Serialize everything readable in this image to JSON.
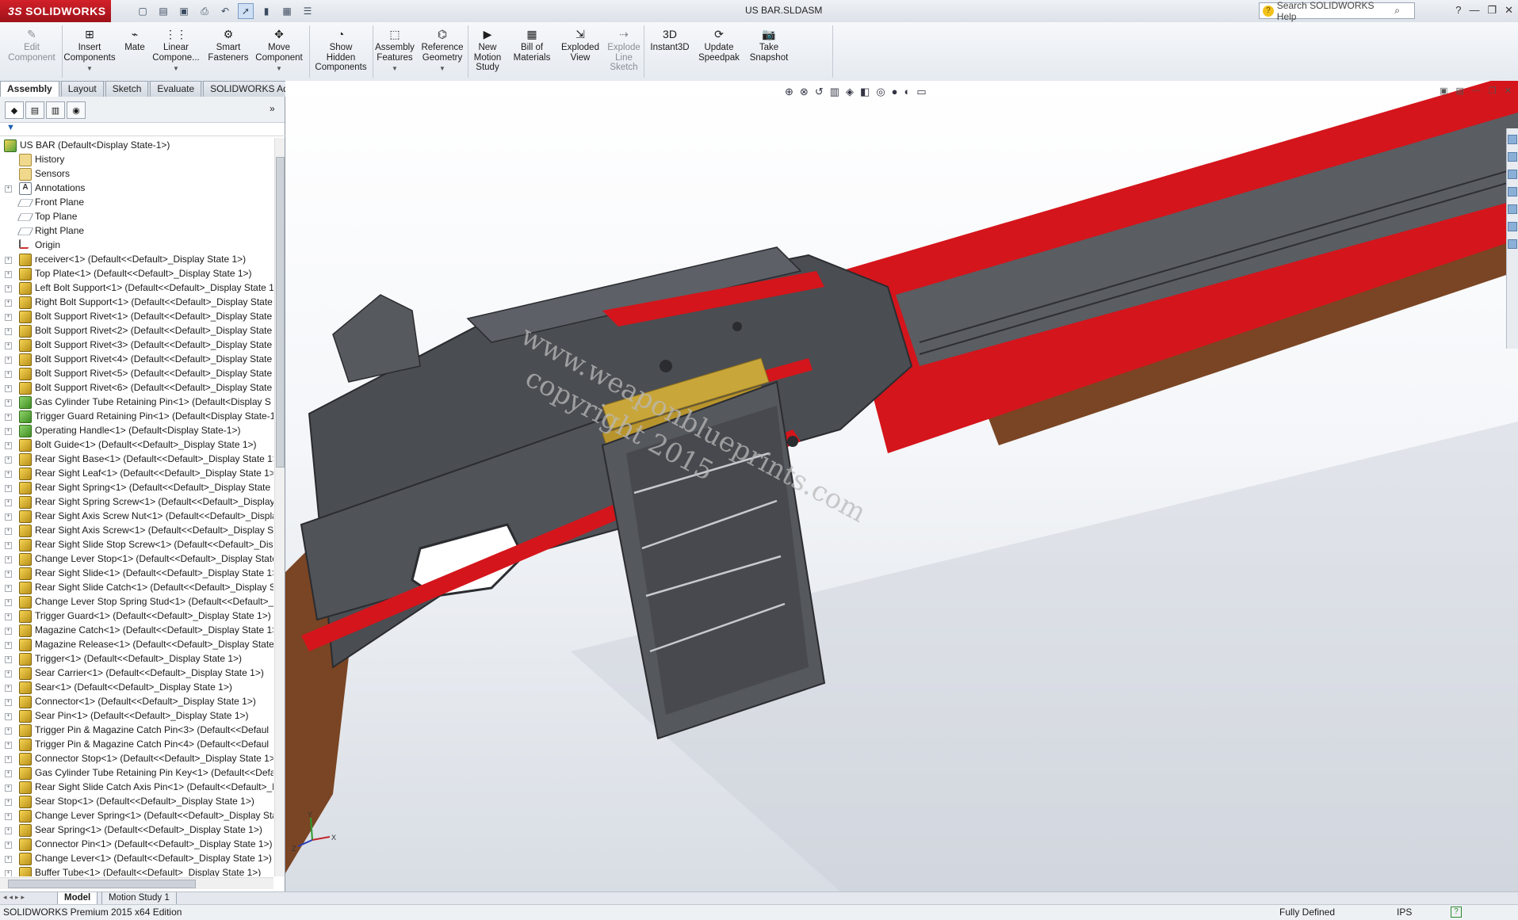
{
  "app": {
    "brand": "SOLIDWORKS",
    "brand_prefix": "3S",
    "document_title": "US BAR.SLDASM"
  },
  "help_search": {
    "placeholder": "Search SOLIDWORKS Help"
  },
  "commands": [
    {
      "label": "Edit\nComponent",
      "icon": "edit-component-icon",
      "disabled": true
    },
    {
      "label": "Insert\nComponents",
      "icon": "insert-components-icon",
      "dropdown": true
    },
    {
      "label": "Mate",
      "icon": "mate-icon"
    },
    {
      "label": "Linear\nCompone...",
      "icon": "linear-pattern-icon",
      "dropdown": true
    },
    {
      "label": "Smart\nFasteners",
      "icon": "smart-fasteners-icon"
    },
    {
      "label": "Move\nComponent",
      "icon": "move-component-icon",
      "dropdown": true
    },
    {
      "label": "Show\nHidden\nComponents",
      "icon": "show-hidden-icon"
    },
    {
      "label": "Assembly\nFeatures",
      "icon": "assembly-features-icon",
      "dropdown": true
    },
    {
      "label": "Reference\nGeometry",
      "icon": "reference-geometry-icon",
      "dropdown": true
    },
    {
      "label": "New\nMotion\nStudy",
      "icon": "motion-study-icon"
    },
    {
      "label": "Bill of\nMaterials",
      "icon": "bom-icon"
    },
    {
      "label": "Exploded\nView",
      "icon": "exploded-view-icon"
    },
    {
      "label": "Explode\nLine\nSketch",
      "icon": "explode-line-sketch-icon",
      "disabled": true
    },
    {
      "label": "Instant3D",
      "icon": "instant3d-icon"
    },
    {
      "label": "Update\nSpeedpak",
      "icon": "speedpak-icon"
    },
    {
      "label": "Take\nSnapshot",
      "icon": "snapshot-icon"
    }
  ],
  "tabs": [
    "Assembly",
    "Layout",
    "Sketch",
    "Evaluate",
    "SOLIDWORKS Add-Ins"
  ],
  "active_tab": "Assembly",
  "tree": {
    "root": "US BAR  (Default<Display State-1>)",
    "items": [
      {
        "label": "History",
        "icon": "folder"
      },
      {
        "label": "Sensors",
        "icon": "folder"
      },
      {
        "label": "Annotations",
        "icon": "ann",
        "expand": true
      },
      {
        "label": "Front Plane",
        "icon": "plane"
      },
      {
        "label": "Top Plane",
        "icon": "plane"
      },
      {
        "label": "Right Plane",
        "icon": "plane"
      },
      {
        "label": "Origin",
        "icon": "origin"
      },
      {
        "label": "receiver<1> (Default<<Default>_Display State 1>)",
        "icon": "part",
        "expand": true
      },
      {
        "label": "Top Plate<1> (Default<<Default>_Display State 1>)",
        "icon": "part",
        "expand": true
      },
      {
        "label": "Left Bolt Support<1> (Default<<Default>_Display State 1",
        "icon": "part",
        "expand": true
      },
      {
        "label": "Right Bolt Support<1> (Default<<Default>_Display State",
        "icon": "part",
        "expand": true
      },
      {
        "label": "Bolt Support Rivet<1> (Default<<Default>_Display State",
        "icon": "part",
        "expand": true
      },
      {
        "label": "Bolt Support Rivet<2> (Default<<Default>_Display State",
        "icon": "part",
        "expand": true
      },
      {
        "label": "Bolt Support Rivet<3> (Default<<Default>_Display State",
        "icon": "part",
        "expand": true
      },
      {
        "label": "Bolt Support Rivet<4> (Default<<Default>_Display State",
        "icon": "part",
        "expand": true
      },
      {
        "label": "Bolt Support Rivet<5> (Default<<Default>_Display State",
        "icon": "part",
        "expand": true
      },
      {
        "label": "Bolt Support Rivet<6> (Default<<Default>_Display State",
        "icon": "part",
        "expand": true
      },
      {
        "label": "Gas Cylinder Tube Retaining Pin<1> (Default<Display S",
        "icon": "part-green",
        "expand": true
      },
      {
        "label": "Trigger Guard Retaining Pin<1> (Default<Display State-1",
        "icon": "part-green",
        "expand": true
      },
      {
        "label": "Operating Handle<1> (Default<Display State-1>)",
        "icon": "part-green",
        "expand": true
      },
      {
        "label": "Bolt Guide<1> (Default<<Default>_Display State 1>)",
        "icon": "part",
        "expand": true
      },
      {
        "label": "Rear Sight Base<1> (Default<<Default>_Display State 1>",
        "icon": "part",
        "expand": true
      },
      {
        "label": "Rear Sight Leaf<1> (Default<<Default>_Display State 1>)",
        "icon": "part",
        "expand": true
      },
      {
        "label": "Rear Sight Spring<1> (Default<<Default>_Display State 1",
        "icon": "part",
        "expand": true
      },
      {
        "label": "Rear Sight Spring Screw<1> (Default<<Default>_Display",
        "icon": "part",
        "expand": true
      },
      {
        "label": "Rear Sight Axis Screw Nut<1> (Default<<Default>_Displa",
        "icon": "part",
        "expand": true
      },
      {
        "label": "Rear Sight Axis Screw<1> (Default<<Default>_Display St",
        "icon": "part",
        "expand": true
      },
      {
        "label": "Rear Sight Slide Stop Screw<1> (Default<<Default>_Disp",
        "icon": "part",
        "expand": true
      },
      {
        "label": "Change Lever Stop<1> (Default<<Default>_Display State",
        "icon": "part",
        "expand": true
      },
      {
        "label": "Rear Sight Slide<1> (Default<<Default>_Display State 1>",
        "icon": "part",
        "expand": true
      },
      {
        "label": "Rear Sight Slide Catch<1> (Default<<Default>_Display St",
        "icon": "part",
        "expand": true
      },
      {
        "label": "Change Lever Stop Spring Stud<1> (Default<<Default>_",
        "icon": "part",
        "expand": true
      },
      {
        "label": "Trigger Guard<1> (Default<<Default>_Display State 1>)",
        "icon": "part",
        "expand": true
      },
      {
        "label": "Magazine Catch<1> (Default<<Default>_Display State 1>",
        "icon": "part",
        "expand": true
      },
      {
        "label": "Magazine Release<1> (Default<<Default>_Display State",
        "icon": "part",
        "expand": true
      },
      {
        "label": "Trigger<1> (Default<<Default>_Display State 1>)",
        "icon": "part",
        "expand": true
      },
      {
        "label": "Sear Carrier<1> (Default<<Default>_Display State 1>)",
        "icon": "part",
        "expand": true
      },
      {
        "label": "Sear<1> (Default<<Default>_Display State 1>)",
        "icon": "part",
        "expand": true
      },
      {
        "label": "Connector<1> (Default<<Default>_Display State 1>)",
        "icon": "part",
        "expand": true
      },
      {
        "label": "Sear Pin<1> (Default<<Default>_Display State 1>)",
        "icon": "part",
        "expand": true
      },
      {
        "label": "Trigger Pin & Magazine Catch Pin<3> (Default<<Defaul",
        "icon": "part",
        "expand": true
      },
      {
        "label": "Trigger Pin & Magazine Catch Pin<4> (Default<<Defaul",
        "icon": "part",
        "expand": true
      },
      {
        "label": "Connector Stop<1> (Default<<Default>_Display State 1>",
        "icon": "part",
        "expand": true
      },
      {
        "label": "Gas Cylinder Tube Retaining Pin Key<1> (Default<<Defa",
        "icon": "part",
        "expand": true
      },
      {
        "label": "Rear Sight Slide Catch Axis Pin<1> (Default<<Default>_D",
        "icon": "part",
        "expand": true
      },
      {
        "label": "Sear Stop<1> (Default<<Default>_Display State 1>)",
        "icon": "part",
        "expand": true
      },
      {
        "label": "Change Lever Spring<1> (Default<<Default>_Display Sta",
        "icon": "part",
        "expand": true
      },
      {
        "label": "Sear Spring<1> (Default<<Default>_Display State 1>)",
        "icon": "part",
        "expand": true
      },
      {
        "label": "Connector Pin<1> (Default<<Default>_Display State 1>)",
        "icon": "part",
        "expand": true
      },
      {
        "label": "Change Lever<1> (Default<<Default>_Display State 1>)",
        "icon": "part",
        "expand": true
      },
      {
        "label": "Buffer Tube<1> (Default<<Default>_Display State 1>)",
        "icon": "part",
        "expand": true
      }
    ]
  },
  "viewport": {
    "watermark_line1": "www.weaponblueprints.com",
    "watermark_line2": "copyright 2015",
    "triad_labels": {
      "x": "X",
      "y": "Y",
      "z": "Z"
    }
  },
  "bottom_tabs": [
    "Model",
    "Motion Study 1"
  ],
  "active_bottom_tab": "Model",
  "status": {
    "edition": "SOLIDWORKS Premium 2015 x64 Edition",
    "state": "Fully Defined",
    "units": "IPS",
    "help": "?"
  },
  "colors": {
    "brand_red": "#c8202a",
    "section_red": "#d4151b",
    "gun_gray": "#4a4d52",
    "wood": "#7a4524",
    "brass": "#c9a63a"
  }
}
